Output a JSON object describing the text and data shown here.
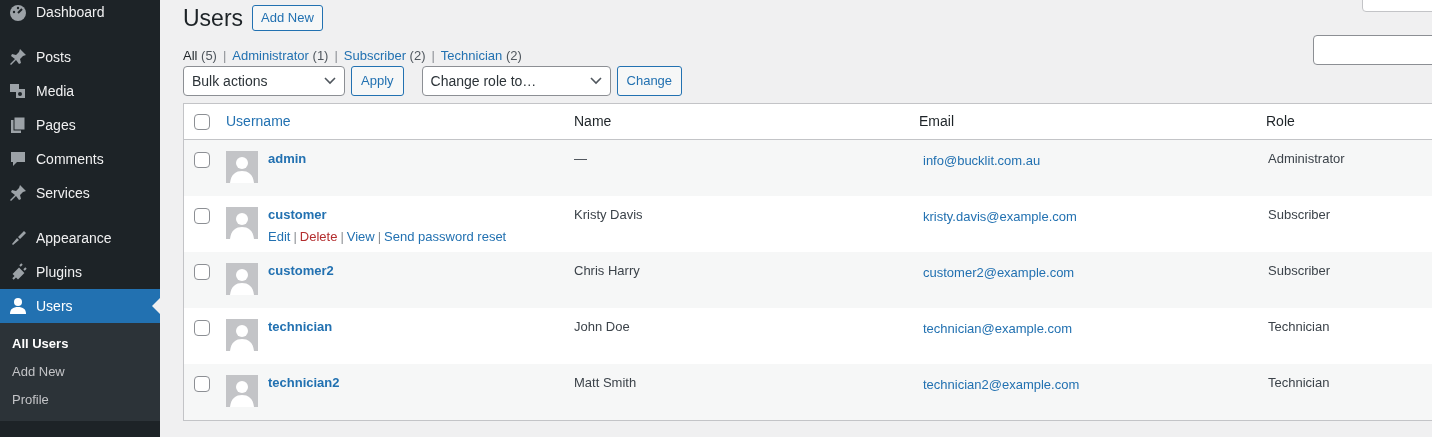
{
  "sidebar": {
    "items": [
      {
        "label": "Dashboard",
        "selected": false
      },
      {
        "label": "Posts",
        "selected": false
      },
      {
        "label": "Media",
        "selected": false
      },
      {
        "label": "Pages",
        "selected": false
      },
      {
        "label": "Comments",
        "selected": false
      },
      {
        "label": "Services",
        "selected": false
      },
      {
        "label": "Appearance",
        "selected": false
      },
      {
        "label": "Plugins",
        "selected": false
      },
      {
        "label": "Users",
        "selected": true,
        "submenu": [
          {
            "label": "All Users",
            "selected": true
          },
          {
            "label": "Add New",
            "selected": false
          },
          {
            "label": "Profile",
            "selected": false
          }
        ]
      }
    ]
  },
  "title": "Users",
  "add_new": "Add New",
  "separator": "|",
  "filters": [
    {
      "label": "All",
      "count": "(5)",
      "selected": true
    },
    {
      "label": "Administrator",
      "count": "(1)",
      "selected": false
    },
    {
      "label": "Subscriber",
      "count": "(2)",
      "selected": false
    },
    {
      "label": "Technician",
      "count": "(2)",
      "selected": false
    }
  ],
  "bulk_actions": {
    "value": "Bulk actions",
    "button": "Apply"
  },
  "change_role": {
    "value": "Change role to…",
    "button": "Change"
  },
  "table": {
    "all_checked": false,
    "columns": [
      "Username",
      "Name",
      "Email",
      "Role"
    ],
    "rows": [
      {
        "username": "admin",
        "name": "—",
        "email": "info@bucklit.com.au",
        "role": "Administrator",
        "checked": false,
        "actions": []
      },
      {
        "username": "customer",
        "name": "Kristy Davis",
        "email": "kristy.davis@example.com",
        "role": "Subscriber",
        "checked": false,
        "actions": [
          {
            "label": "Edit",
            "kind": "link"
          },
          {
            "label": "Delete",
            "kind": "danger"
          },
          {
            "label": "View",
            "kind": "link"
          },
          {
            "label": "Send password reset",
            "kind": "link"
          }
        ]
      },
      {
        "username": "customer2",
        "name": "Chris Harry",
        "email": "customer2@example.com",
        "role": "Subscriber",
        "checked": false,
        "actions": []
      },
      {
        "username": "technician",
        "name": "John Doe",
        "email": "technician@example.com",
        "role": "Technician",
        "checked": false,
        "actions": []
      },
      {
        "username": "technician2",
        "name": "Matt Smith",
        "email": "technician2@example.com",
        "role": "Technician",
        "checked": false,
        "actions": []
      }
    ]
  }
}
